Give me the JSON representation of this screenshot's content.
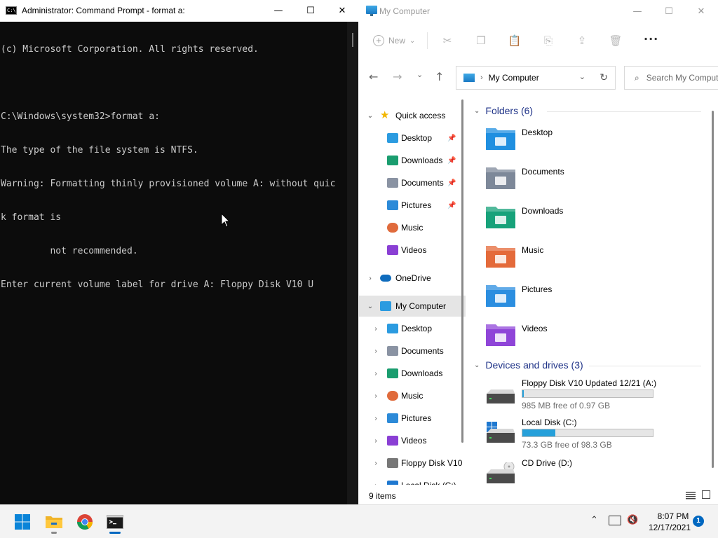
{
  "cmd": {
    "title": "Administrator: Command Prompt - format  a:",
    "icon_text": "C:\\",
    "lines": [
      "(c) Microsoft Corporation. All rights reserved.",
      "",
      "C:\\Windows\\system32>format a:",
      "The type of the file system is NTFS.",
      "Warning: Formatting thinly provisioned volume A: without quic",
      "k format is",
      "         not recommended.",
      "Enter current volume label for drive A: Floppy Disk V10 U"
    ],
    "controls": {
      "minimize": "—",
      "maximize": "☐",
      "close": "✕"
    }
  },
  "explorer": {
    "title": "My Computer",
    "controls": {
      "minimize": "—",
      "maximize": "☐",
      "close": "✕"
    },
    "toolbar": {
      "new_label": "New",
      "new_chevron": "⌄",
      "more": "···",
      "icons": {
        "cut": "✂",
        "copy": "❐",
        "paste": "📋",
        "rename": "⎘",
        "share": "⇪",
        "delete": "🗑"
      }
    },
    "nav": {
      "back": "←",
      "forward": "→",
      "recent": "⌄",
      "up": "↑"
    },
    "address": {
      "separator": "›",
      "location": "My Computer",
      "dropdown": "⌄",
      "refresh": "↻"
    },
    "search": {
      "icon": "⌕",
      "placeholder": "Search My Computer"
    },
    "sidebar": {
      "items": [
        {
          "label": "Quick access",
          "chev": "⌄",
          "icon": "star-icon",
          "color": "#f2b600",
          "pinned": false
        },
        {
          "label": "Desktop",
          "chev": "",
          "icon": "desktop-icon",
          "color": "#2b9be0",
          "pinned": true
        },
        {
          "label": "Downloads",
          "chev": "",
          "icon": "downloads-icon",
          "color": "#1a9d6f",
          "pinned": true
        },
        {
          "label": "Documents",
          "chev": "",
          "icon": "documents-icon",
          "color": "#8a93a3",
          "pinned": true
        },
        {
          "label": "Pictures",
          "chev": "",
          "icon": "pictures-icon",
          "color": "#2c8ad8",
          "pinned": true
        },
        {
          "label": "Music",
          "chev": "",
          "icon": "music-icon",
          "color": "#e06b3c",
          "pinned": false
        },
        {
          "label": "Videos",
          "chev": "",
          "icon": "videos-icon",
          "color": "#8a3fd4",
          "pinned": false
        },
        {
          "label": "OneDrive",
          "chev": "›",
          "icon": "onedrive-icon",
          "color": "#0f6cbd",
          "pinned": false
        },
        {
          "label": "My Computer",
          "chev": "⌄",
          "icon": "computer-icon",
          "color": "#2b9be0",
          "pinned": false
        },
        {
          "label": "Desktop",
          "chev": "›",
          "icon": "desktop-icon",
          "color": "#2b9be0",
          "pinned": false
        },
        {
          "label": "Documents",
          "chev": "›",
          "icon": "documents-icon",
          "color": "#8a93a3",
          "pinned": false
        },
        {
          "label": "Downloads",
          "chev": "›",
          "icon": "downloads-icon",
          "color": "#1a9d6f",
          "pinned": false
        },
        {
          "label": "Music",
          "chev": "›",
          "icon": "music-icon",
          "color": "#e06b3c",
          "pinned": false
        },
        {
          "label": "Pictures",
          "chev": "›",
          "icon": "pictures-icon",
          "color": "#2c8ad8",
          "pinned": false
        },
        {
          "label": "Videos",
          "chev": "›",
          "icon": "videos-icon",
          "color": "#8a3fd4",
          "pinned": false
        },
        {
          "label": "Floppy Disk V10",
          "chev": "›",
          "icon": "floppy-drive-icon",
          "color": "#777777",
          "pinned": false
        },
        {
          "label": "Local Disk (C:)",
          "chev": "›",
          "icon": "local-disk-icon",
          "color": "#1e78d0",
          "pinned": false
        }
      ],
      "pin_glyph": "📌"
    },
    "groups": {
      "folders_header": "Folders (6)",
      "drives_header": "Devices and drives (3)",
      "chevron": "⌄"
    },
    "folders": [
      {
        "label": "Desktop",
        "icon": "desktop-folder-icon",
        "color": "#1f8fe0"
      },
      {
        "label": "Documents",
        "icon": "documents-folder-icon",
        "color": "#7d8899"
      },
      {
        "label": "Downloads",
        "icon": "downloads-folder-icon",
        "color": "#17a27a"
      },
      {
        "label": "Music",
        "icon": "music-folder-icon",
        "color": "#e46a3a"
      },
      {
        "label": "Pictures",
        "icon": "pictures-folder-icon",
        "color": "#2b8ee0"
      },
      {
        "label": "Videos",
        "icon": "videos-folder-icon",
        "color": "#8f45d8"
      }
    ],
    "drives": [
      {
        "label": "Floppy Disk V10 Updated 12/21 (A:)",
        "free": "985 MB free of 0.97 GB",
        "used_fraction": 0.01,
        "icon": "floppy-drive-icon",
        "has_bar": true
      },
      {
        "label": "Local Disk (C:)",
        "free": "73.3 GB free of 98.3 GB",
        "used_fraction": 0.25,
        "icon": "windows-drive-icon",
        "has_bar": true
      },
      {
        "label": "CD Drive (D:)",
        "free": "",
        "used_fraction": 0,
        "icon": "cd-drive-icon",
        "has_bar": false
      }
    ],
    "status": {
      "item_count": "9 items"
    }
  },
  "taskbar": {
    "apps": [
      {
        "name": "start-button",
        "icon": "windows-logo-icon",
        "running": false
      },
      {
        "name": "file-explorer-taskbar-button",
        "icon": "folder-icon",
        "running": true
      },
      {
        "name": "chrome-taskbar-button",
        "icon": "chrome-icon",
        "running": false
      },
      {
        "name": "command-prompt-taskbar-button",
        "icon": "terminal-icon",
        "running": true
      }
    ],
    "tray_up": "⌃",
    "volume": "🔇",
    "time": "8:07 PM",
    "date": "12/17/2021",
    "notifications": "1"
  },
  "colors": {
    "accent": "#0067c0",
    "drive_bar": "#26a0da",
    "console_bg": "#0c0c0c",
    "console_fg": "#cccccc"
  }
}
